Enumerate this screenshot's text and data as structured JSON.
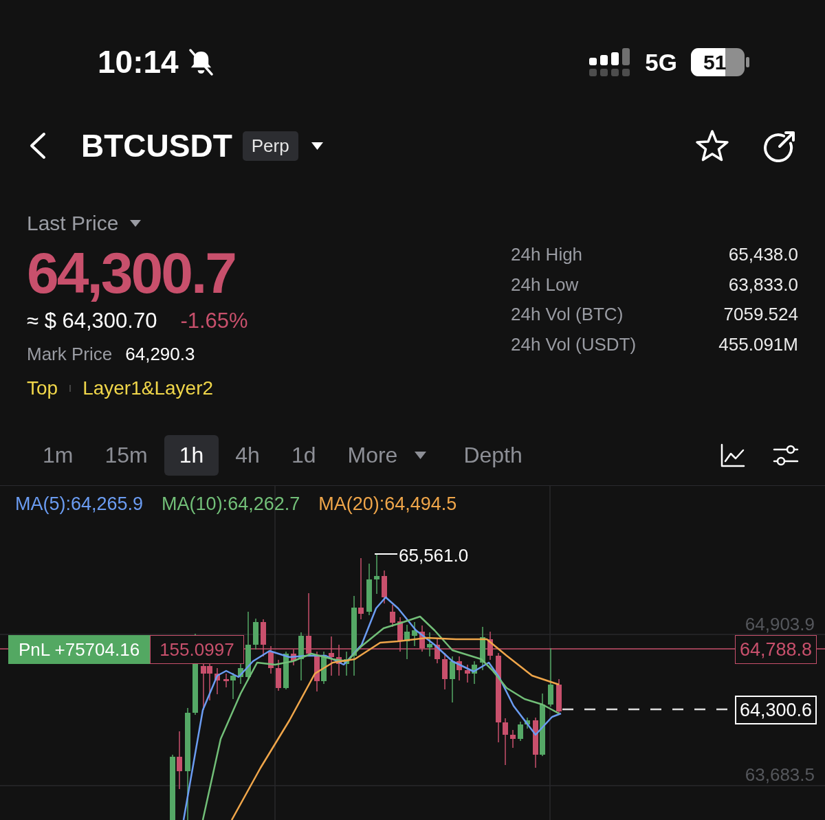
{
  "status_bar": {
    "time": "10:14",
    "network": "5G",
    "battery": "51"
  },
  "header": {
    "symbol": "BTCUSDT",
    "badge": "Perp"
  },
  "price": {
    "label": "Last Price",
    "last": "64,300.7",
    "approx": "≈ $ 64,300.70",
    "change": "-1.65%",
    "mark_label": "Mark Price",
    "mark": "64,290.3",
    "categories": [
      "Top",
      "Layer1&Layer2"
    ]
  },
  "stats": [
    {
      "label": "24h High",
      "value": "65,438.0"
    },
    {
      "label": "24h Low",
      "value": "63,833.0"
    },
    {
      "label": "24h Vol (BTC)",
      "value": "7059.524"
    },
    {
      "label": "24h Vol (USDT)",
      "value": "455.091M"
    }
  ],
  "intervals": [
    {
      "label": "1m",
      "kind": "interval",
      "selected": false
    },
    {
      "label": "15m",
      "kind": "interval",
      "selected": false
    },
    {
      "label": "1h",
      "kind": "interval",
      "selected": true
    },
    {
      "label": "4h",
      "kind": "interval",
      "selected": false
    },
    {
      "label": "1d",
      "kind": "interval",
      "selected": false
    },
    {
      "label": "More",
      "kind": "menu",
      "selected": false
    },
    {
      "label": "Depth",
      "kind": "view",
      "selected": false
    }
  ],
  "chart": {
    "indicators": [
      {
        "label": "MA(5):64,265.9",
        "color": "#6b9cf2"
      },
      {
        "label": "MA(10):64,262.7",
        "color": "#72bf78"
      },
      {
        "label": "MA(20):64,494.5",
        "color": "#f0a64a"
      }
    ],
    "high_label": "65,561.0",
    "axis_labels": [
      "64,903.9",
      "63,683.5"
    ],
    "position": {
      "pnl": "PnL +75704.16",
      "size": "155.0997",
      "price": "64,788.8"
    },
    "current_price": "64,300.6"
  }
}
